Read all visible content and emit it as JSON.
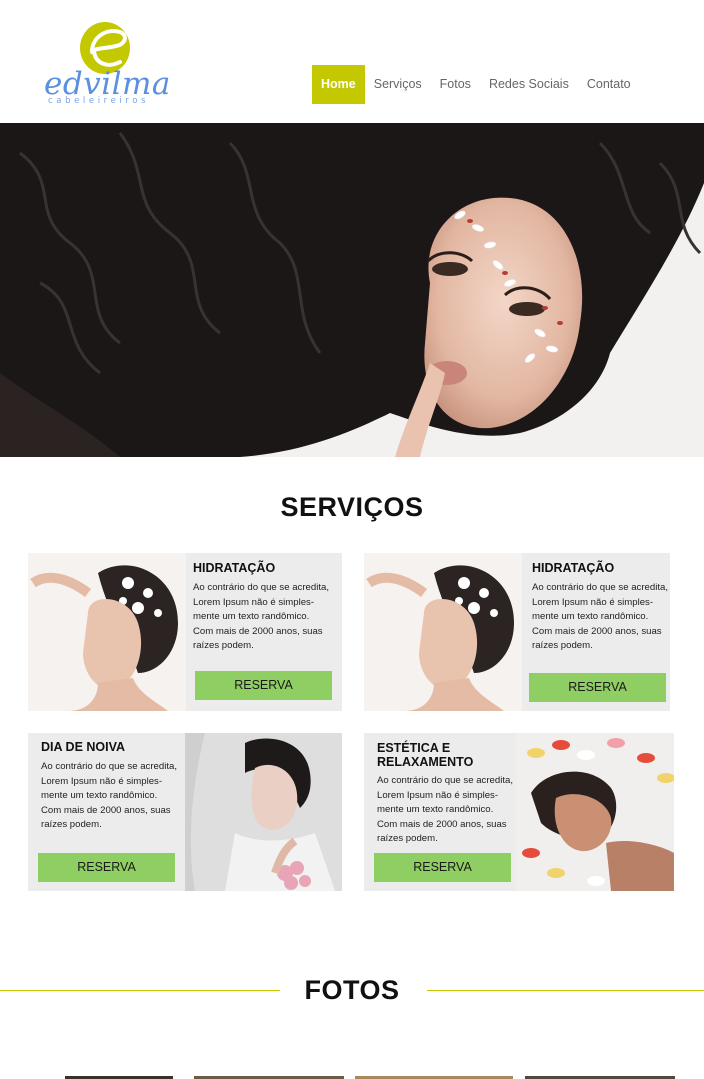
{
  "brand": {
    "name": "edvilma",
    "tagline": "cabeleireiros",
    "accent_color": "#c3c800",
    "logo_color": "#5b8fe0",
    "button_color": "#8fce62"
  },
  "nav": {
    "items": [
      {
        "label": "Home",
        "active": true
      },
      {
        "label": "Serviços",
        "active": false
      },
      {
        "label": "Fotos",
        "active": false
      },
      {
        "label": "Redes Sociais",
        "active": false
      },
      {
        "label": "Contato",
        "active": false
      }
    ]
  },
  "services": {
    "title": "SERVIÇOS",
    "cards": [
      {
        "title": "HIDRATAÇÃO",
        "text": [
          "Ao contrário do que se acredita,",
          "Lorem Ipsum não é simples-",
          "mente um texto randômico.",
          "Com mais de 2000 anos, suas",
          "raízes podem."
        ],
        "button": "RESERVA"
      },
      {
        "title": "HIDRATAÇÃO",
        "text": [
          "Ao contrário do que se acredita,",
          "Lorem Ipsum não é simples-",
          "mente um texto randômico.",
          "Com mais de 2000 anos, suas",
          "raízes podem."
        ],
        "button": "RESERVA"
      },
      {
        "title": "DIA DE NOIVA",
        "text": [
          "Ao contrário do que se acredita,",
          "Lorem Ipsum não é simples-",
          "mente um texto randômico.",
          "Com mais de 2000 anos, suas",
          "raízes podem."
        ],
        "button": "RESERVA"
      },
      {
        "title_lines": [
          "ESTÉTICA E",
          "RELAXAMENTO"
        ],
        "text": [
          "Ao contrário do que se acredita,",
          "Lorem Ipsum não é simples-",
          "mente um texto randômico.",
          "Com mais de 2000 anos, suas",
          "raízes podem."
        ],
        "button": "RESERVA"
      }
    ]
  },
  "fotos": {
    "title": "FOTOS"
  }
}
